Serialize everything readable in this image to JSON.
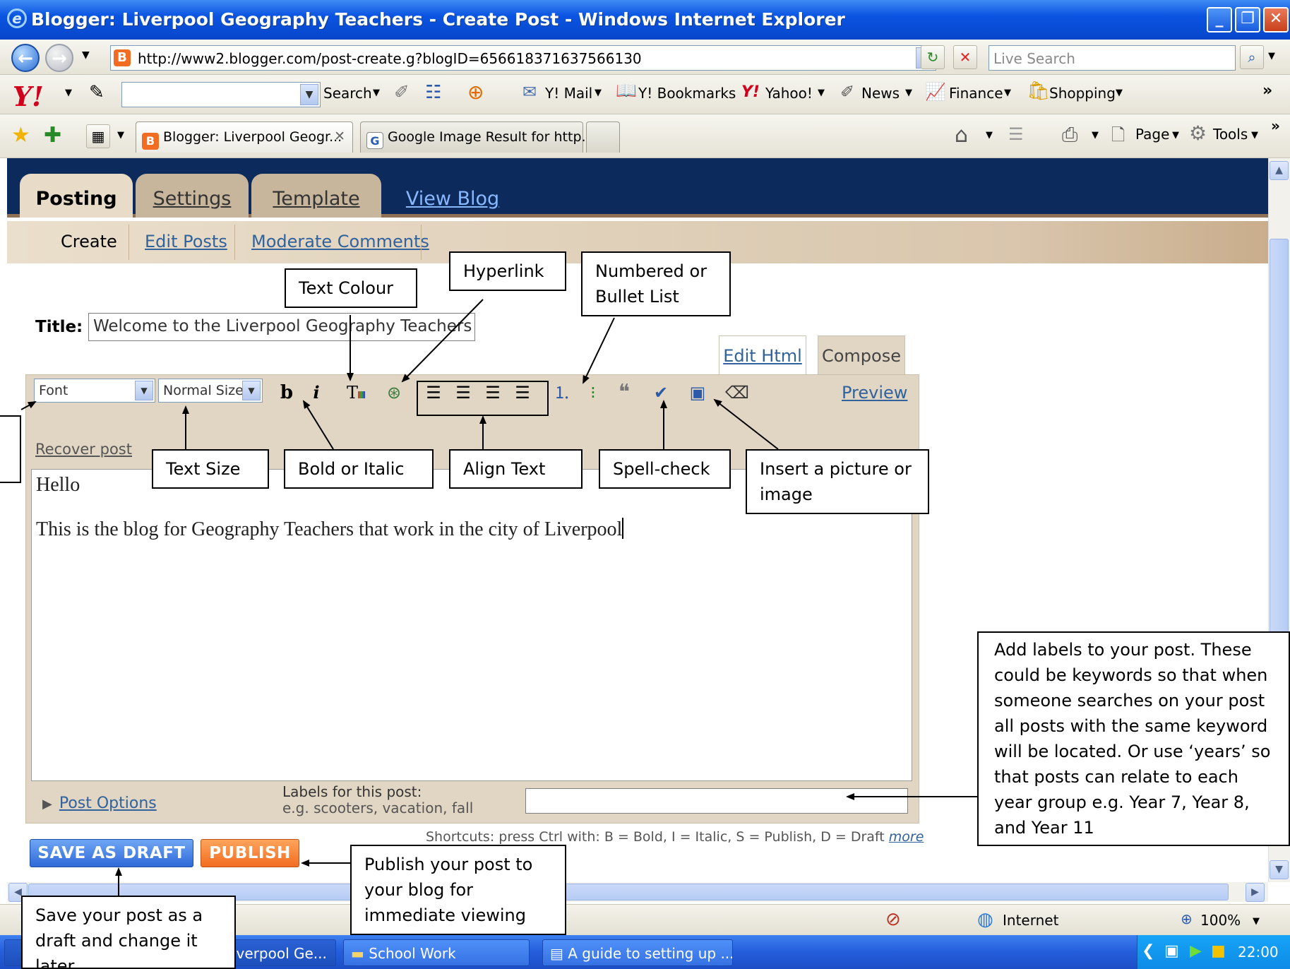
{
  "window": {
    "title": "Blogger: Liverpool Geography Teachers - Create Post - Windows Internet Explorer",
    "controls": [
      "minimize",
      "restore",
      "close"
    ]
  },
  "address_bar": {
    "url": "http://www2.blogger.com/post-create.g?blogID=6566183716375661​30",
    "search_placeholder": "Live Search"
  },
  "yahoo_toolbar": {
    "logo": "Y!",
    "search_label": "Search",
    "items": [
      "Y! Mail",
      "Y! Bookmarks",
      "Yahoo!",
      "News",
      "Finance",
      "Shopping"
    ],
    "more": "»"
  },
  "tabs": {
    "items": [
      {
        "label": "Blogger: Liverpool Geogr...",
        "close": "✕",
        "active": true
      },
      {
        "label": "Google Image Result for http...",
        "active": false
      }
    ],
    "commands": [
      "Page",
      "Tools"
    ],
    "more": "»"
  },
  "blogger": {
    "main_tabs": [
      "Posting",
      "Settings",
      "Template",
      "View Blog"
    ],
    "sub_tabs": [
      "Create",
      "Edit Posts",
      "Moderate Comments"
    ],
    "title_label": "Title:",
    "title_value": "Welcome to the Liverpool Geography Teachers Blog",
    "mode_tabs": [
      "Edit Html",
      "Compose"
    ],
    "toolbar": {
      "font": "Font",
      "size": "Normal Size",
      "bold": "b",
      "italic": "i",
      "preview": "Preview"
    },
    "recover_post": "Recover post",
    "content": {
      "line1": "Hello",
      "line2": "This is the blog for Geography Teachers that work in the city of Liverpool"
    },
    "post_options": "Post Options",
    "labels_label": "Labels for this post:",
    "labels_hint": "e.g. scooters, vacation, fall",
    "shortcuts": "Shortcuts: press Ctrl with: B = Bold, I = Italic, S = Publish, D = Draft",
    "shortcuts_more": "more",
    "save_draft": "SAVE AS DRAFT",
    "publish": "PUBLISH"
  },
  "status_bar": {
    "zone": "Internet",
    "zoom": "100%"
  },
  "taskbar": {
    "items": [
      "iverpool Ge...",
      "School Work",
      "A guide to setting up ..."
    ],
    "clock": "22:00"
  },
  "annotations": {
    "text_colour": "Text Colour",
    "hyperlink": "Hyperlink",
    "numbered_list": "Numbered or Bullet List",
    "text_size": "Text Size",
    "bold_italic": "Bold or Italic",
    "align_text": "Align Text",
    "spell_check": "Spell-check",
    "insert_picture": "Insert a picture or image",
    "labels": "Add labels to your post. These could be keywords so that when someone searches on your post all posts with the same keyword will be located.  Or use ‘years’ so that posts can relate to each year group e.g. Year 7, Year 8, and Year 11",
    "publish": "Publish your post to your blog for immediate viewing",
    "save_draft": "Save your post as a draft and change it later"
  },
  "colors": {
    "title_bar": "#0a54e2",
    "blogger_nav": "#0c2a5c",
    "save_button": "#2f6ad8",
    "publish_button": "#f26d21",
    "link": "#31629b"
  }
}
